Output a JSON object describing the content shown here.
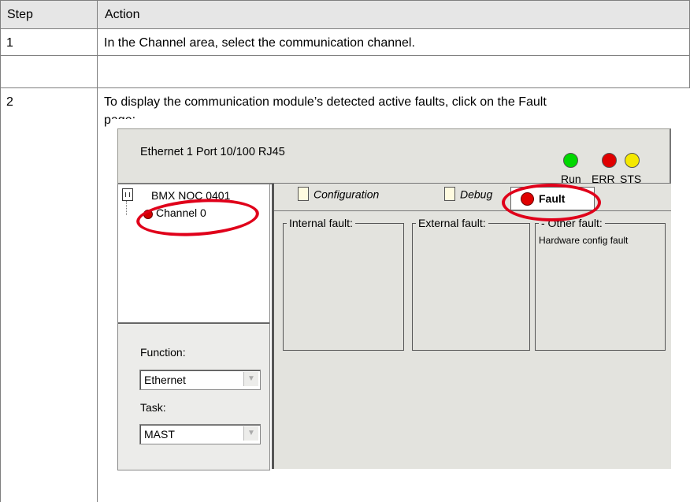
{
  "table": {
    "header": {
      "step": "Step",
      "action": "Action"
    },
    "rows": [
      {
        "step": "1",
        "pre": "In the ",
        "bold": "Channel area,",
        "post": " select the communication channel."
      },
      {
        "step": "2",
        "line1": "To display the communication module’s detected active faults, click on the ",
        "bold": "Fault",
        "line2": "page:"
      }
    ]
  },
  "screenshot": {
    "module_title": "Ethernet 1 Port 10/100 RJ45",
    "leds": [
      {
        "label": "Run",
        "color": "#00d800"
      },
      {
        "label": "ERR",
        "color": "#e00000"
      },
      {
        "label": "STS",
        "color": "#f4e800"
      }
    ],
    "tree": {
      "device": "BMX NOC 0401",
      "channel": "Channel 0"
    },
    "function_label": "Function:",
    "function_value": "Ethernet",
    "task_label": "Task:",
    "task_value": "MAST",
    "tabs": {
      "configuration": "Configuration",
      "debug": "Debug",
      "fault": "Fault"
    },
    "fault_groups": [
      {
        "title": "Internal fault:",
        "value": ""
      },
      {
        "title": "External fault:",
        "value": ""
      },
      {
        "title": "- Other fault:",
        "value": "Hardware config fault"
      }
    ],
    "annotation_color": "#e0001a"
  }
}
